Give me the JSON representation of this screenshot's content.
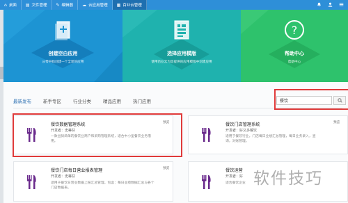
{
  "topbar": {
    "tabs": [
      {
        "label": "桌面",
        "icon": "home-icon",
        "glyph": "⌂"
      },
      {
        "label": "文件管理",
        "icon": "file-icon",
        "glyph": "▤"
      },
      {
        "label": "编辑器",
        "icon": "edit-icon",
        "glyph": "✎"
      },
      {
        "label": "云应用管理",
        "icon": "cloud-icon",
        "glyph": "☁"
      },
      {
        "label": "百业云管理",
        "icon": "grid-icon",
        "glyph": "▦"
      }
    ],
    "active_tab": 4,
    "right_icons": [
      "bell-icon",
      "user-icon",
      "menu-icon"
    ]
  },
  "banner": [
    {
      "title": "创建空白应用",
      "subtitle": "从零开始创建一个全新的应用",
      "icon": "add-document-icon",
      "color": "#1d94d3"
    },
    {
      "title": "选择应用模版",
      "subtitle": "使用百业云为您提供的应用模版中创建应用",
      "icon": "template-icon",
      "color": "#1fb2ae"
    },
    {
      "title": "帮助中心",
      "subtitle": "帮助中心",
      "icon": "help-icon",
      "color": "#2ec26c"
    }
  ],
  "tabs": [
    "最新发布",
    "新手专区",
    "行业分类",
    "精品应用",
    "热门应用"
  ],
  "search": {
    "value": "餐饮",
    "icon": "search-icon"
  },
  "cards": [
    {
      "title": "餐饮数据管理系统",
      "developer": "开发者：史蒂芬",
      "desc": "一款出狱简单的餐饮业商户和采购管理系统，适合中小型餐饮业务借用。",
      "badge": "预览",
      "icon": "cutlery-icon"
    },
    {
      "title": "餐饮门店管理系统",
      "developer": "开发者：好又多餐饮",
      "desc": "适用于餐饮行业，门店每日业绩汇总管理，每日业务录入，查询，对账管理。",
      "badge": "预览",
      "icon": "cutlery-icon"
    },
    {
      "title": "餐饮门店每日营业报表管理",
      "developer": "开发者：史蒂芬",
      "desc": "适用于餐饮日营业数据上报汇总管理，包含：每日业绩数据汇总与各个门店数据表。",
      "badge": "预览",
      "icon": "cutlery-icon"
    },
    {
      "title": "餐饮运营",
      "developer": "开发者：好",
      "desc": "适合餐饮企业",
      "badge": "",
      "icon": "cutlery-icon"
    }
  ],
  "watermark": "软件技巧",
  "colors": {
    "accent": "#2e8fd8",
    "highlight": "#e03a3a",
    "card_icon": "#6a2a8c"
  }
}
